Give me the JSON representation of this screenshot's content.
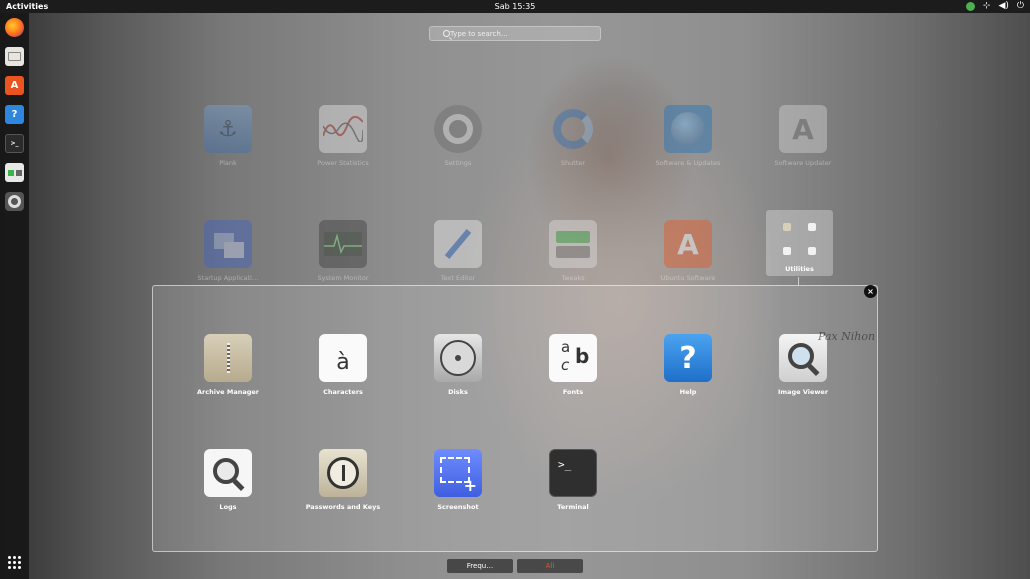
{
  "topbar": {
    "activities": "Activities",
    "clock": "Sab 15:35"
  },
  "dock": {
    "items": [
      "firefox-icon",
      "files-icon",
      "ubuntu-software-icon",
      "help-icon",
      "terminal-icon",
      "system-monitor-icon",
      "settings-icon"
    ]
  },
  "search": {
    "placeholder": "Type to search…"
  },
  "grid": {
    "row1": [
      "Plank",
      "Power Statistics",
      "Settings",
      "Shutter",
      "Software & Updates",
      "Software Updater"
    ],
    "row2": [
      "Startup Applicati…",
      "System Monitor",
      "Text Editor",
      "Tweaks",
      "Ubuntu Software"
    ]
  },
  "folder": {
    "label": "Utilities"
  },
  "popup": {
    "row1": [
      "Archive Manager",
      "Characters",
      "Disks",
      "Fonts",
      "Help",
      "Image Viewer"
    ],
    "row2": [
      "Logs",
      "Passwords and Keys",
      "Screenshot",
      "Terminal"
    ],
    "characters_glyph": "à",
    "fonts_glyph_a": "a",
    "fonts_glyph_c": "c",
    "fonts_glyph_b": "b",
    "help_glyph": "?",
    "terminal_glyph": ">_",
    "close_glyph": "×"
  },
  "tabs": {
    "frequent": "Frequ…",
    "all": "All"
  },
  "colors": {
    "accent": "#e95420",
    "help_blue": "#2e86de",
    "screenshot_blue": "#4f6fe0"
  },
  "watermark": "Pax Nihon"
}
